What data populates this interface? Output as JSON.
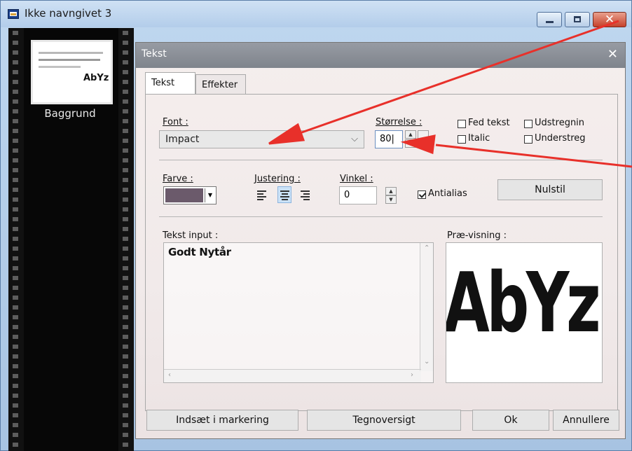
{
  "window": {
    "title": "Ikke navngivet 3"
  },
  "layers": [
    {
      "name": "Baggrund",
      "thumb_text": "AbYz"
    }
  ],
  "dialog": {
    "title": "Tekst",
    "close": "✕",
    "tabs": [
      {
        "label": "Tekst",
        "active": true
      },
      {
        "label": "Effekter",
        "active": false
      }
    ],
    "font": {
      "label": "Font :",
      "value": "Impact"
    },
    "size": {
      "label": "Størrelse :",
      "value": "80"
    },
    "styles": [
      {
        "label": "Fed tekst",
        "checked": false
      },
      {
        "label": "Udstregnin",
        "checked": false
      },
      {
        "label": "Italic",
        "checked": false
      },
      {
        "label": "Understreg",
        "checked": false
      }
    ],
    "color": {
      "label": "Farve :",
      "value": "#6b5a6b"
    },
    "alignment": {
      "label": "Justering :",
      "options": [
        "left",
        "center",
        "right"
      ],
      "selected": "center"
    },
    "angle": {
      "label": "Vinkel :",
      "value": "0"
    },
    "antialias": {
      "label": "Antialias",
      "checked": true
    },
    "reset_button": "Nulstil",
    "text_input": {
      "label": "Tekst input :",
      "value": "Godt Nytår"
    },
    "preview": {
      "label": "Præ-visning :",
      "sample": "AbYz"
    },
    "buttons": {
      "insert": "Indsæt i markering",
      "charmap": "Tegnoversigt",
      "ok": "Ok",
      "cancel": "Annullere"
    }
  },
  "colors": {
    "annotation": "#e8302a",
    "dialog_title": "#8a8e96",
    "film": "#111111"
  }
}
